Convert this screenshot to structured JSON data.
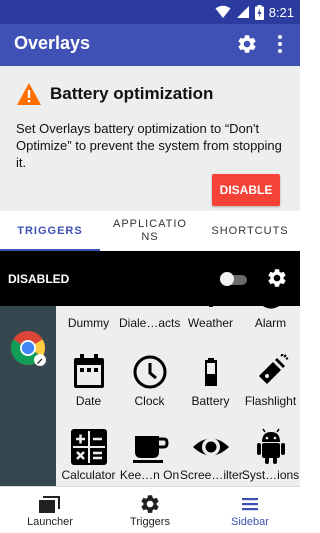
{
  "status_bar": {
    "time": "8:21",
    "icons": [
      "wifi-icon",
      "signal-icon",
      "battery-charging-icon"
    ]
  },
  "app_bar": {
    "title": "Overlays",
    "icons": [
      "gear-icon",
      "more-vert-icon"
    ]
  },
  "banner": {
    "title": "Battery optimization",
    "message": "Set Overlays battery optimization to “Don't Optimize” to prevent the system from stopping it.",
    "button_label": "DISABLE",
    "icon": "warning-icon"
  },
  "tabs": [
    {
      "label": "TRIGGERS",
      "active": true
    },
    {
      "label": "APPLICATIONS",
      "active": false
    },
    {
      "label": "SHORTCUTS",
      "active": false
    }
  ],
  "overlay_bar": {
    "label": "DISABLED",
    "toggle_on": false,
    "icon": "gear-icon"
  },
  "sidebar": {
    "app_icon": "chrome-icon"
  },
  "grid": {
    "row1": [
      "Dummy",
      "Diale…acts",
      "Weather",
      "Alarm"
    ],
    "row2": [
      "Date",
      "Clock",
      "Battery",
      "Flashlight"
    ],
    "row3": [
      "Calculator",
      "Kee…n On",
      "Scree…ilter",
      "Syst…ions"
    ]
  },
  "bottom_nav": [
    {
      "label": "Launcher",
      "icon": "launcher-icon",
      "active": false
    },
    {
      "label": "Triggers",
      "icon": "triggers-gear-icon",
      "active": false
    },
    {
      "label": "Sidebar",
      "icon": "sidebar-menu-icon",
      "active": true
    }
  ],
  "colors": {
    "primary": "#3f51b5",
    "status_bar": "#2c3c9e",
    "accent_button": "#f44336",
    "warning": "#ff6f00",
    "sidebar": "#37474f"
  }
}
